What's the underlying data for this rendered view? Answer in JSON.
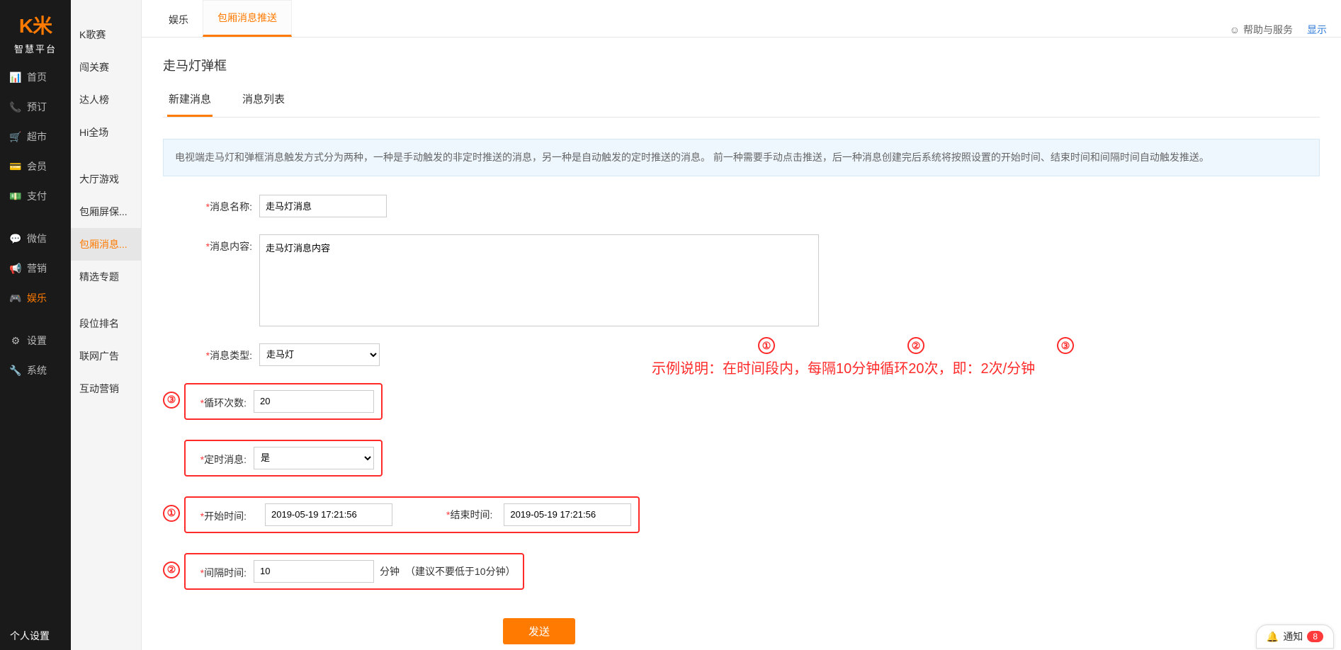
{
  "brand": {
    "logo": "K米",
    "logo_sub": "智慧平台"
  },
  "nav": {
    "items": [
      {
        "icon": "📊",
        "label": "首页"
      },
      {
        "icon": "📞",
        "label": "预订"
      },
      {
        "icon": "🛒",
        "label": "超市"
      },
      {
        "icon": "💳",
        "label": "会员"
      },
      {
        "icon": "💵",
        "label": "支付"
      },
      {
        "icon": "💬",
        "label": "微信"
      },
      {
        "icon": "📢",
        "label": "营销"
      },
      {
        "icon": "🎮",
        "label": "娱乐",
        "active": true
      },
      {
        "icon": "⚙",
        "label": "设置"
      },
      {
        "icon": "🔧",
        "label": "系统"
      }
    ],
    "bottom": "个人设置"
  },
  "submenu": {
    "items": [
      "K歌赛",
      "闯关赛",
      "达人榜",
      "Hi全场"
    ],
    "items2": [
      "大厅游戏",
      "包厢屏保...",
      "包厢消息...",
      "精选专题"
    ],
    "items3": [
      "段位排名",
      "联网广告",
      "互动营销"
    ],
    "active": "包厢消息..."
  },
  "top": {
    "tabs": [
      "娱乐",
      "包厢消息推送"
    ],
    "active": "包厢消息推送",
    "help": "帮助与服务",
    "show": "显示"
  },
  "panel": {
    "title": "走马灯弹框",
    "inner_tabs": [
      "新建消息",
      "消息列表"
    ],
    "active_inner": "新建消息"
  },
  "info": "电视端走马灯和弹框消息触发方式分为两种，一种是手动触发的非定时推送的消息，另一种是自动触发的定时推送的消息。 前一种需要手动点击推送，后一种消息创建完后系统将按照设置的开始时间、结束时间和间隔时间自动触发推送。",
  "form": {
    "name_label": "消息名称:",
    "name_value": "走马灯消息",
    "content_label": "消息内容:",
    "content_value": "走马灯消息内容",
    "type_label": "消息类型:",
    "type_value": "走马灯",
    "loop_label": "循环次数:",
    "loop_value": "20",
    "timed_label": "定时消息:",
    "timed_value": "是",
    "start_label": "开始时间:",
    "start_value": "2019-05-19 17:21:56",
    "end_label": "结束时间:",
    "end_value": "2019-05-19 17:21:56",
    "interval_label": "间隔时间:",
    "interval_value": "10",
    "interval_unit": "分钟",
    "interval_hint": "（建议不要低于10分钟）",
    "submit": "发送"
  },
  "example": {
    "c1": "①",
    "c2": "②",
    "c3": "③",
    "n1": "①",
    "n2": "②",
    "n3": "③",
    "text": "示例说明：在时间段内，每隔10分钟循环20次，即：2次/分钟"
  },
  "notif": {
    "label": "通知",
    "count": "8"
  }
}
